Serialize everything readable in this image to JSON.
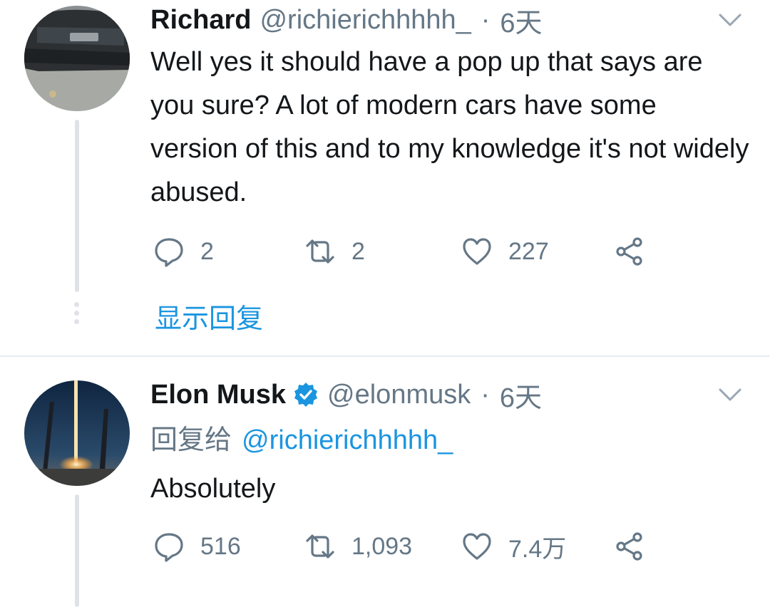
{
  "tweet1": {
    "name": "Richard",
    "handle": "@richierichhhhh_",
    "separator": "·",
    "time": "6天",
    "text": "Well yes it should have a pop up that says are you sure? A lot of modern cars have some version of this and to my knowledge it's not widely abused.",
    "replies": "2",
    "retweets": "2",
    "likes": "227",
    "show_replies": "显示回复"
  },
  "tweet2": {
    "name": "Elon Musk",
    "handle": "@elonmusk",
    "separator": "·",
    "time": "6天",
    "replying_prefix": "回复给",
    "replying_to": "@richierichhhhh_",
    "text": "Absolutely",
    "replies": "516",
    "retweets": "1,093",
    "likes": "7.4万"
  },
  "colors": {
    "accent": "#1b95e0",
    "secondary_text": "#657786",
    "primary_text": "#14171a",
    "thread_line": "#dfe3e7"
  }
}
